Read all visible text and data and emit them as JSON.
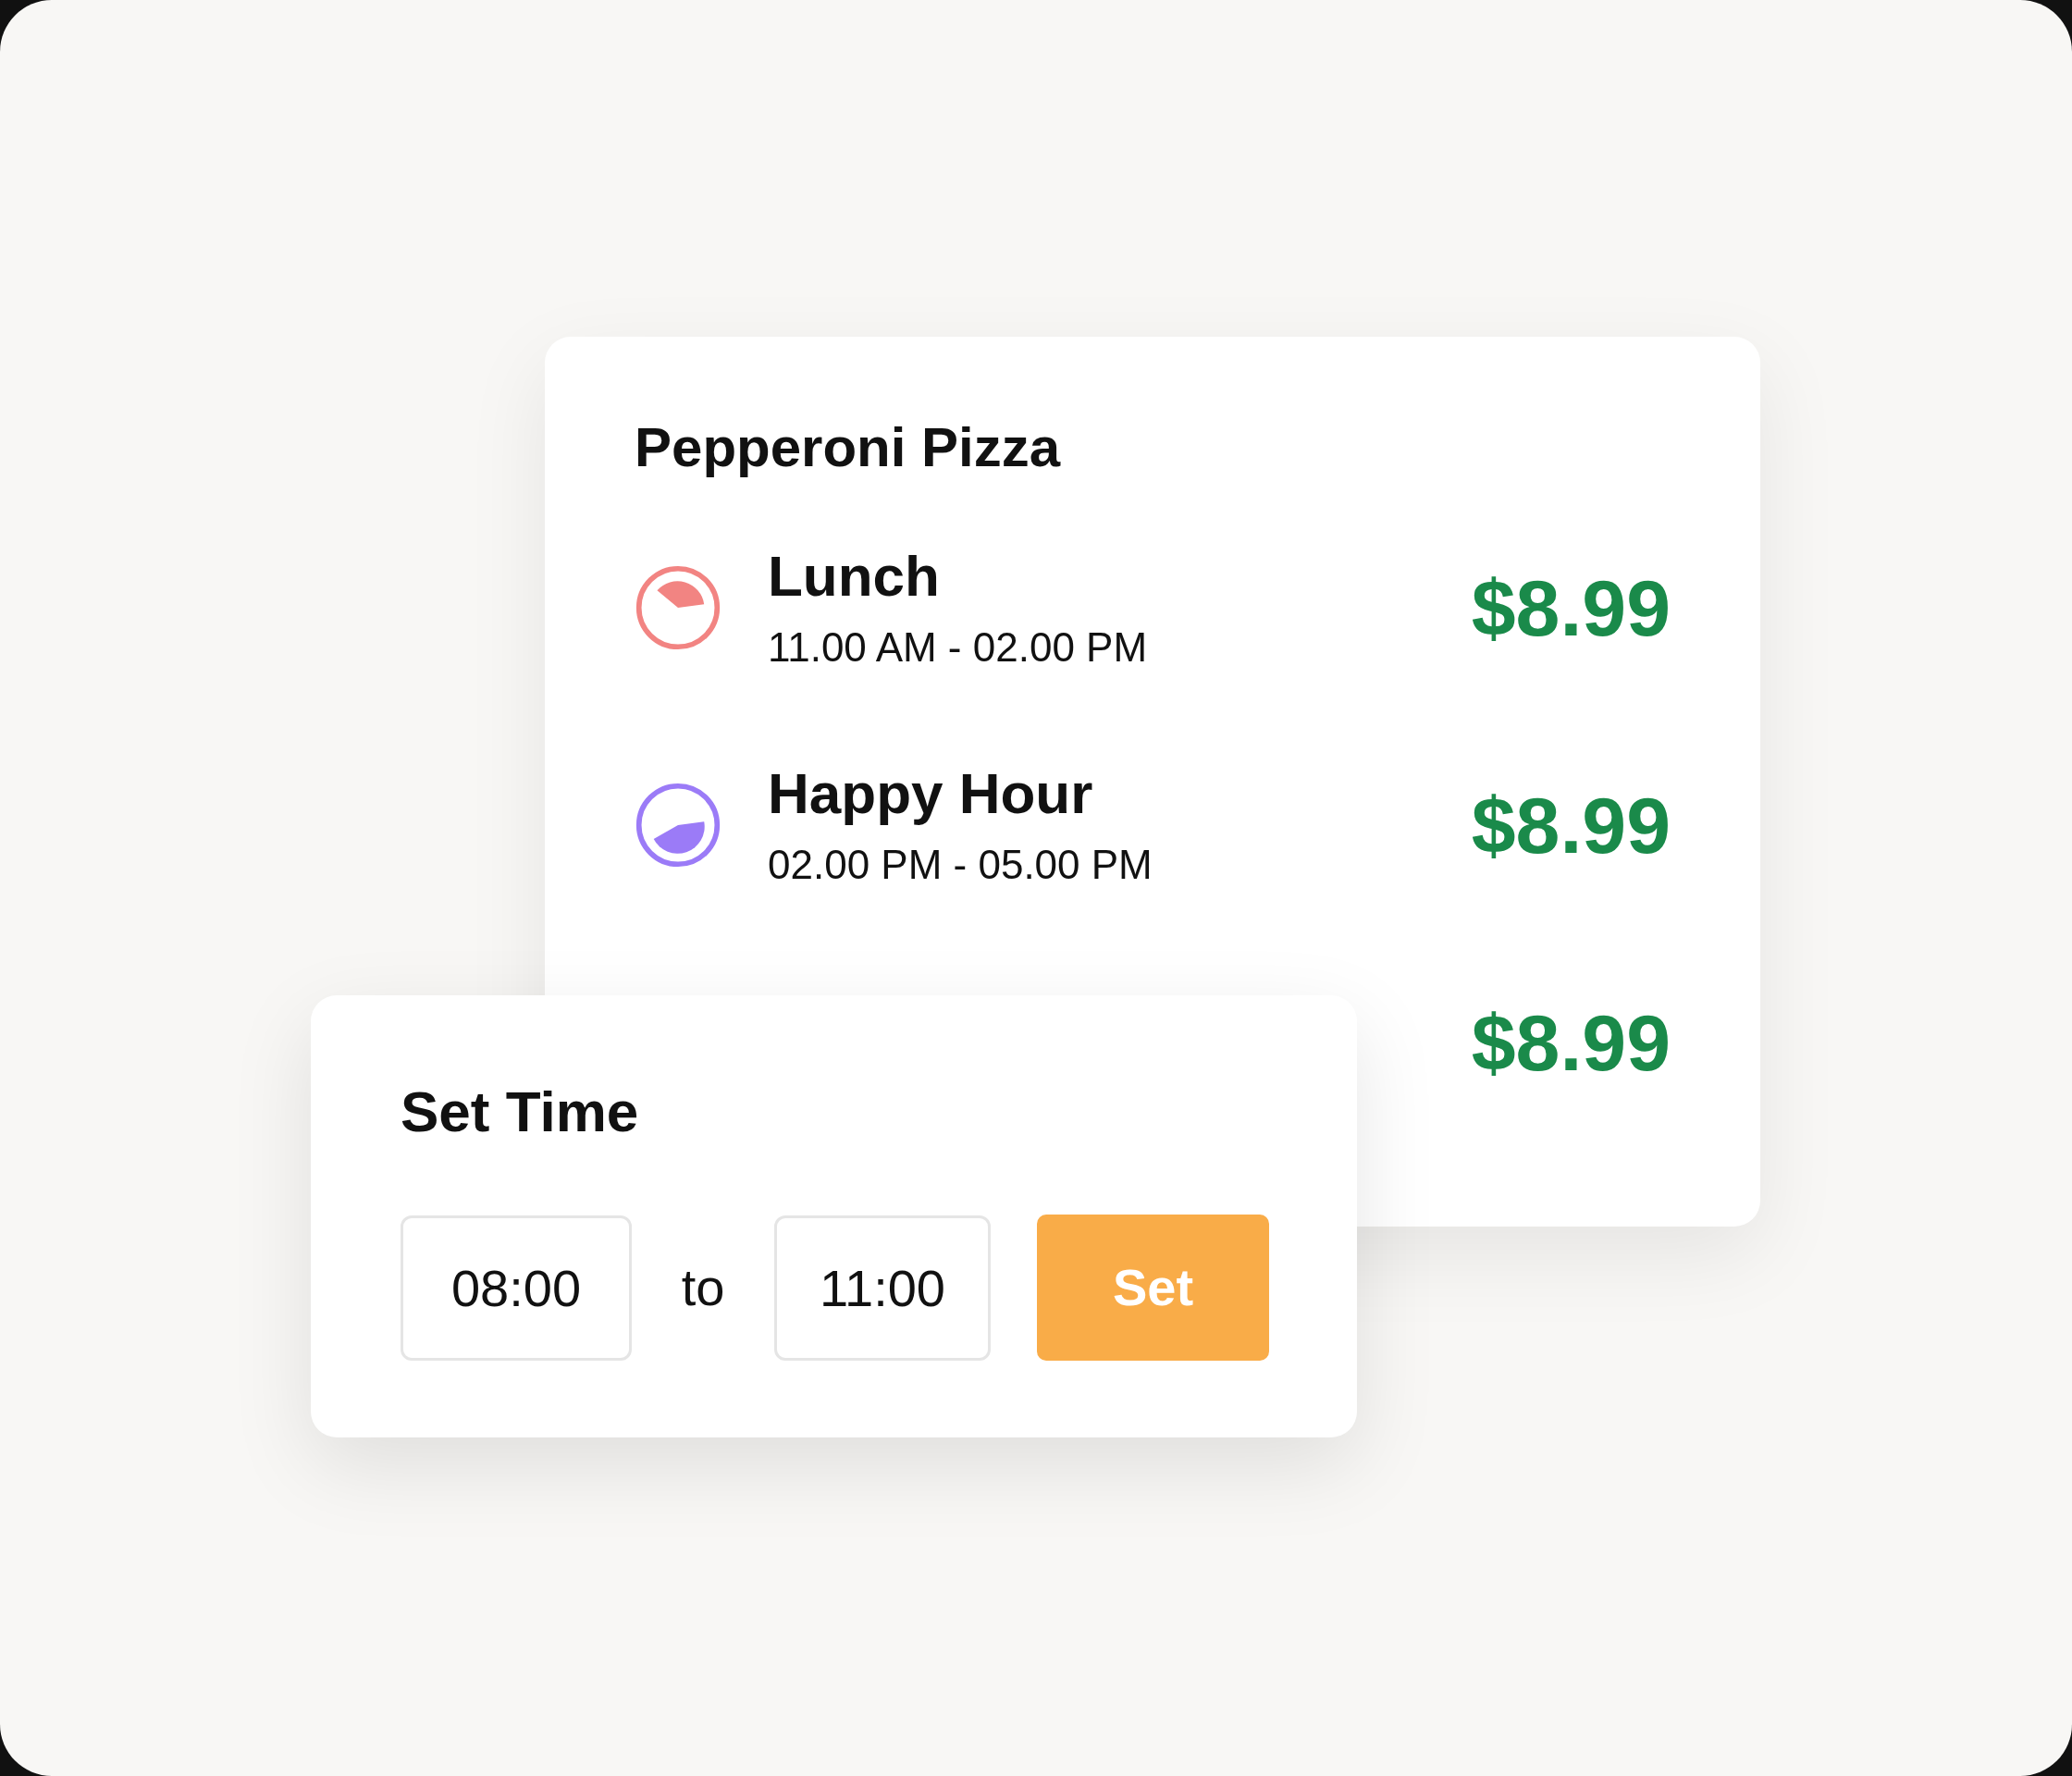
{
  "menu_card": {
    "title": "Pepperoni Pizza",
    "rows": [
      {
        "name": "Lunch",
        "time": "11.00 AM - 02.00 PM",
        "price": "$8.99",
        "color": "#f28482",
        "kind": "morning"
      },
      {
        "name": "Happy Hour",
        "time": "02.00 PM - 05.00 PM",
        "price": "$8.99",
        "color": "#9b7bf7",
        "kind": "afternoon"
      },
      {
        "price": "$8.99"
      }
    ]
  },
  "set_time": {
    "title": "Set Time",
    "from": "08:00",
    "separator": "to",
    "to": "11:00",
    "button": "Set"
  }
}
